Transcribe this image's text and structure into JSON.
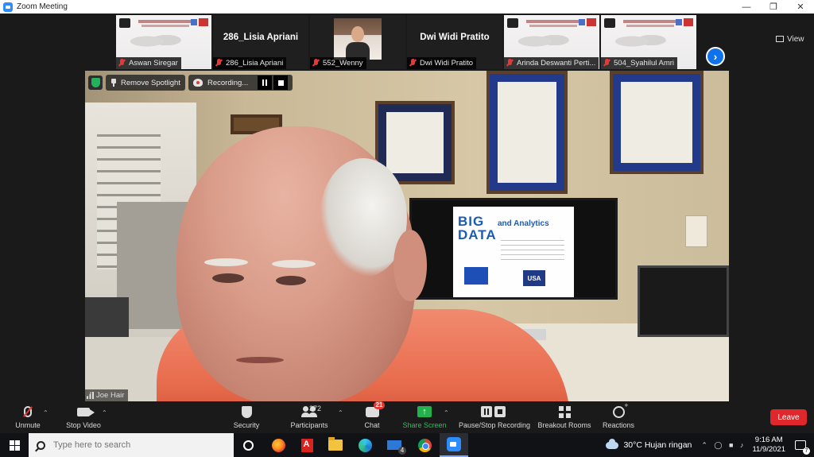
{
  "window": {
    "title": "Zoom Meeting",
    "controls": [
      "minimize",
      "restore",
      "close"
    ]
  },
  "gallery": {
    "thumbnails": [
      {
        "name": "Aswan Siregar",
        "type": "slide",
        "muted": true
      },
      {
        "name": "286_Lisia Apriani",
        "type": "name",
        "muted": true
      },
      {
        "name": "552_Wenny",
        "type": "video",
        "muted": true
      },
      {
        "name": "Dwi Widi Pratito",
        "type": "name",
        "muted": true
      },
      {
        "name": "Arinda Deswanti Perti...",
        "type": "slide",
        "muted": true
      },
      {
        "name": "504_Syahilul Amri",
        "type": "slide",
        "muted": true
      }
    ],
    "view_label": "View"
  },
  "spotlight": {
    "remove_label": "Remove Spotlight",
    "recording_label": "Recording...",
    "speaker_name": "Joe Hair",
    "screen_slide": {
      "big": "BIG",
      "data": "DATA",
      "analytics": "and Analytics",
      "usa": "USA"
    }
  },
  "toolbar": {
    "unmute": "Unmute",
    "stop_video": "Stop Video",
    "security": "Security",
    "participants": "Participants",
    "participant_count": "372",
    "chat": "Chat",
    "chat_badge": "21",
    "share_screen": "Share Screen",
    "pause_stop_recording": "Pause/Stop Recording",
    "breakout_rooms": "Breakout Rooms",
    "reactions": "Reactions",
    "leave": "Leave",
    "share_color": "#22b24c",
    "leave_color": "#e0282c"
  },
  "taskbar": {
    "search_placeholder": "Type here to search",
    "weather": "30°C  Hujan ringan",
    "time": "9:16 AM",
    "date": "11/9/2021",
    "mail_badge": "4",
    "notification_badge": "7"
  }
}
